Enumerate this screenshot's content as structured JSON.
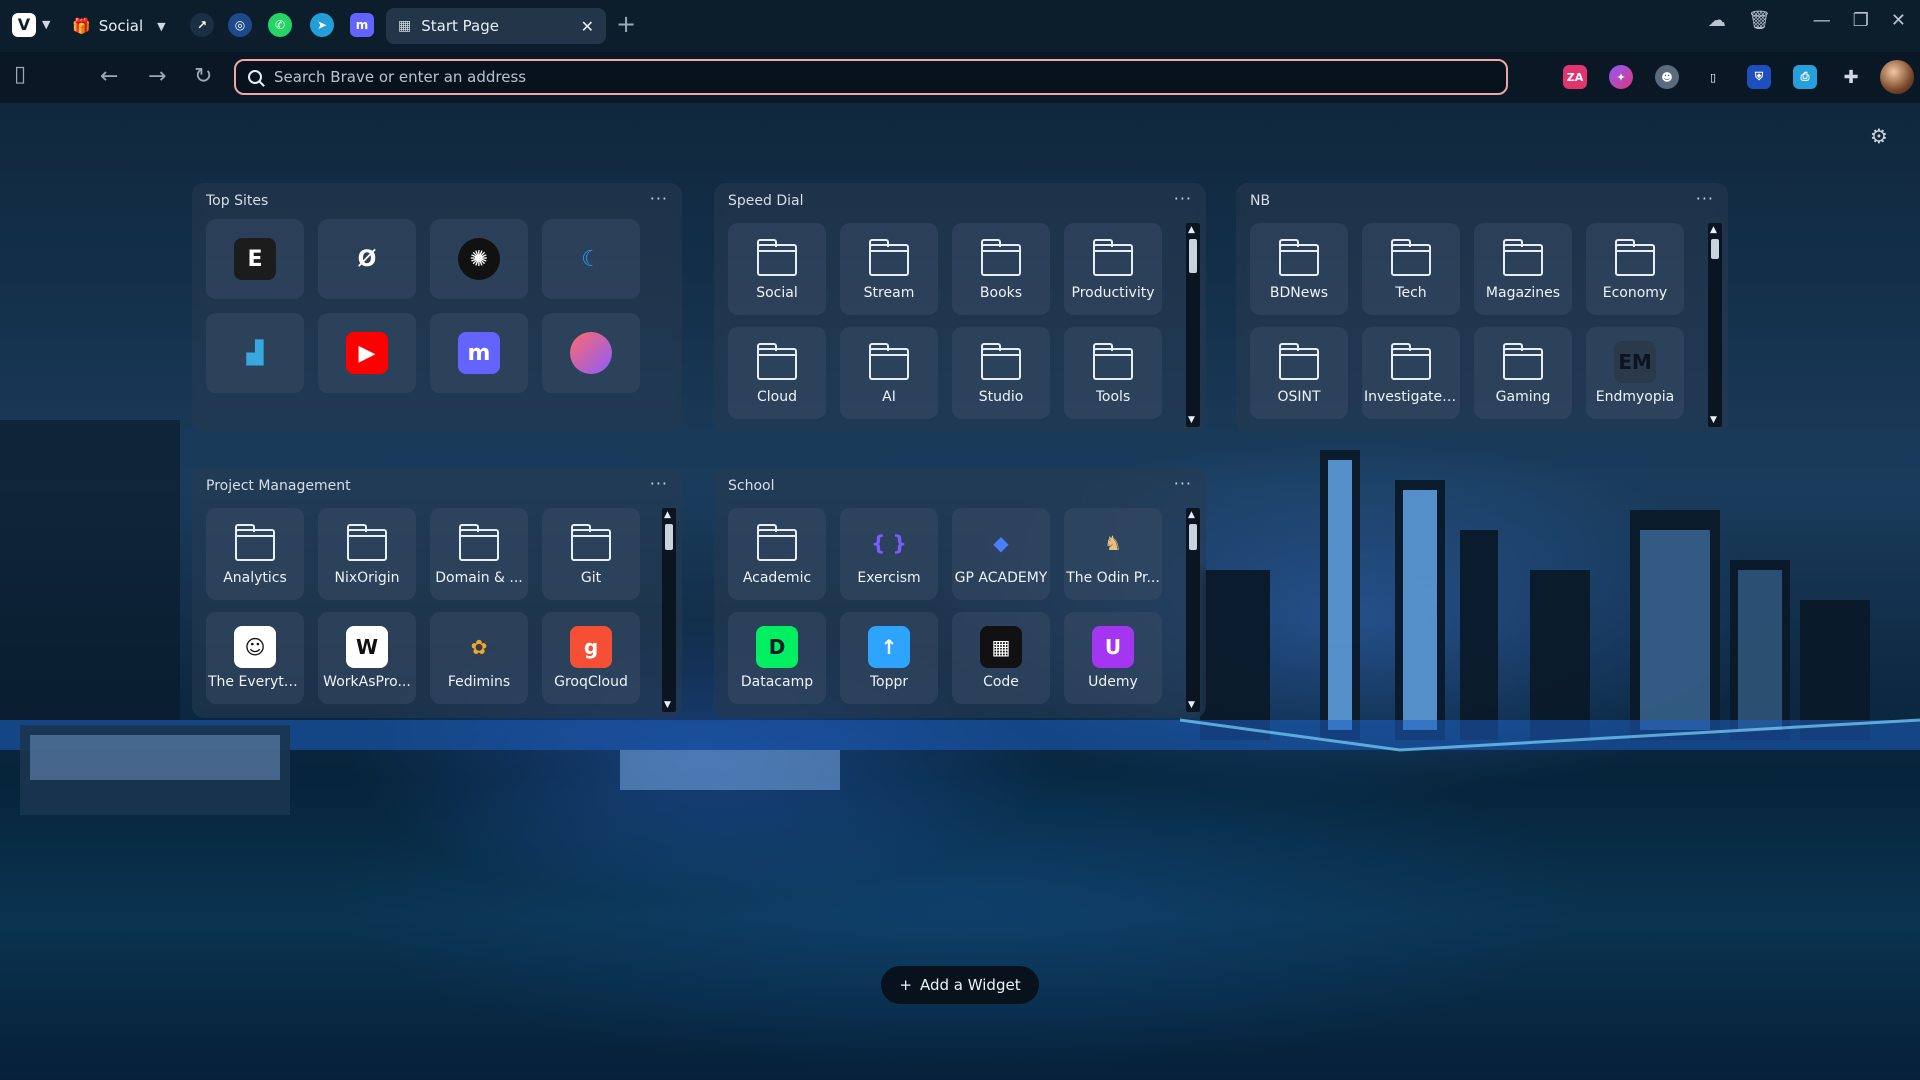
{
  "titlebar": {
    "workspace": "Social",
    "tab_title": "Start Page"
  },
  "address": {
    "placeholder": "Search Brave or enter an address"
  },
  "widgets": {
    "top_sites": {
      "title": "Top Sites",
      "sites": [
        {
          "icon": "E",
          "bg": "#1c1c1c"
        },
        {
          "icon": "Ø",
          "bg": "transparent"
        },
        {
          "icon": "✺",
          "bg": "#111"
        },
        {
          "icon": "☾",
          "bg": "transparent"
        },
        {
          "icon": "▟",
          "bg": "transparent"
        },
        {
          "icon": "▶",
          "bg": "#ff0000"
        },
        {
          "icon": "m",
          "bg": "#6364ff"
        },
        {
          "icon": "◐",
          "bg": "transparent"
        }
      ]
    },
    "speed_dial": {
      "title": "Speed Dial",
      "items": [
        "Social",
        "Stream",
        "Books",
        "Productivity",
        "Cloud",
        "AI",
        "Studio",
        "Tools"
      ]
    },
    "nb": {
      "title": "NB",
      "items": [
        "BDNews",
        "Tech",
        "Magazines",
        "Economy",
        "OSINT",
        "Investigate ...",
        "Gaming",
        "Endmyopia"
      ],
      "endmyopia_icon": "EM"
    },
    "project_management": {
      "title": "Project Management",
      "items": [
        {
          "label": "Analytics",
          "icon": "folder"
        },
        {
          "label": "NixOrigin",
          "icon": "folder"
        },
        {
          "label": "Domain & ...",
          "icon": "folder"
        },
        {
          "label": "Git",
          "icon": "folder"
        },
        {
          "label": "The Everyth...",
          "icon": "☺",
          "bg": "#ffffff",
          "fg": "#111"
        },
        {
          "label": "WorkAsPro...",
          "icon": "W",
          "bg": "#ffffff",
          "fg": "#111"
        },
        {
          "label": "Fedimins",
          "icon": "✿",
          "bg": "transparent",
          "fg": "#f5a623"
        },
        {
          "label": "GroqCloud",
          "icon": "g",
          "bg": "#f55036",
          "fg": "#ffffff"
        }
      ]
    },
    "school": {
      "title": "School",
      "items": [
        {
          "label": "Academic",
          "icon": "folder"
        },
        {
          "label": "Exercism",
          "icon": "{ }",
          "bg": "transparent",
          "fg": "#7b5cff"
        },
        {
          "label": "GP ACADEMY",
          "icon": "◆",
          "bg": "transparent",
          "fg": "#4d7dff"
        },
        {
          "label": "The Odin Pr...",
          "icon": "♞",
          "bg": "transparent",
          "fg": "#e8c07a"
        },
        {
          "label": "Datacamp",
          "icon": "D",
          "bg": "#03ef62",
          "fg": "#05192d"
        },
        {
          "label": "Toppr",
          "icon": "↑",
          "bg": "#2fa4ff",
          "fg": "#ffffff"
        },
        {
          "label": "Code",
          "icon": "▦",
          "bg": "#111111",
          "fg": "#ffffff"
        },
        {
          "label": "Udemy",
          "icon": "U",
          "bg": "#a435f0",
          "fg": "#ffffff"
        }
      ]
    }
  },
  "add_widget_label": "Add a Widget",
  "colors": {
    "accent_url_border": "#f0a6a6",
    "widget_bg": "rgba(40,58,80,0.55)"
  }
}
